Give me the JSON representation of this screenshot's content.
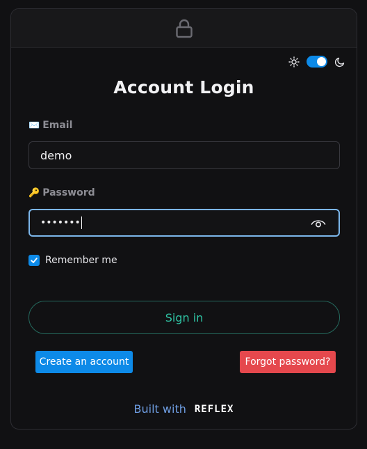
{
  "header": {
    "icon": "lock-icon"
  },
  "theme_toggle": {
    "light_icon": "sun-icon",
    "dark_icon": "moon-icon",
    "state": "on",
    "accent": "#0d8ae8"
  },
  "title": "Account Login",
  "email": {
    "icon": "✉️",
    "label": "Email",
    "value": "demo"
  },
  "password": {
    "icon": "🔑",
    "label": "Password",
    "value": "•••••••",
    "toggle_icon": "eye-icon"
  },
  "remember": {
    "label": "Remember me",
    "checked": true
  },
  "signin": {
    "label": "Sign in",
    "color": "#2fc4a4"
  },
  "create_account": {
    "label": "Create an account",
    "color": "#0d8ae8"
  },
  "forgot_password": {
    "label": "Forgot password?",
    "color": "#e5484d"
  },
  "footer": {
    "built_with": "Built with",
    "brand": "REFLEX"
  }
}
